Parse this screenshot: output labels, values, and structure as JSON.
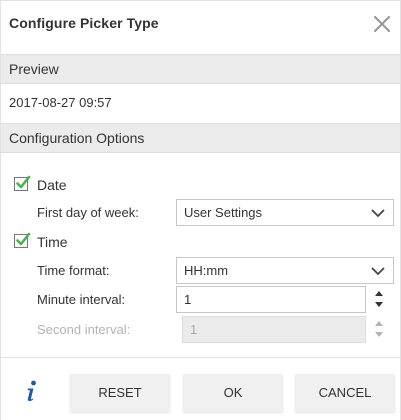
{
  "dialog": {
    "title": "Configure Picker Type",
    "close_icon": "close-x-icon"
  },
  "preview": {
    "header": "Preview",
    "value": "2017-08-27 09:57"
  },
  "config": {
    "header": "Configuration Options",
    "date": {
      "label": "Date",
      "checked": true,
      "first_day_label": "First day of week:",
      "first_day_value": "User Settings"
    },
    "time": {
      "label": "Time",
      "checked": true,
      "format_label": "Time format:",
      "format_value": "HH:mm",
      "minute_label": "Minute interval:",
      "minute_value": "1",
      "second_label": "Second interval:",
      "second_value": "1",
      "second_disabled": true
    }
  },
  "footer": {
    "info_icon": "info-icon",
    "reset_label": "RESET",
    "ok_label": "OK",
    "cancel_label": "CANCEL"
  },
  "colors": {
    "check_green": "#4caf50",
    "info_blue": "#1e5aa8",
    "section_bg": "#ebebeb"
  }
}
